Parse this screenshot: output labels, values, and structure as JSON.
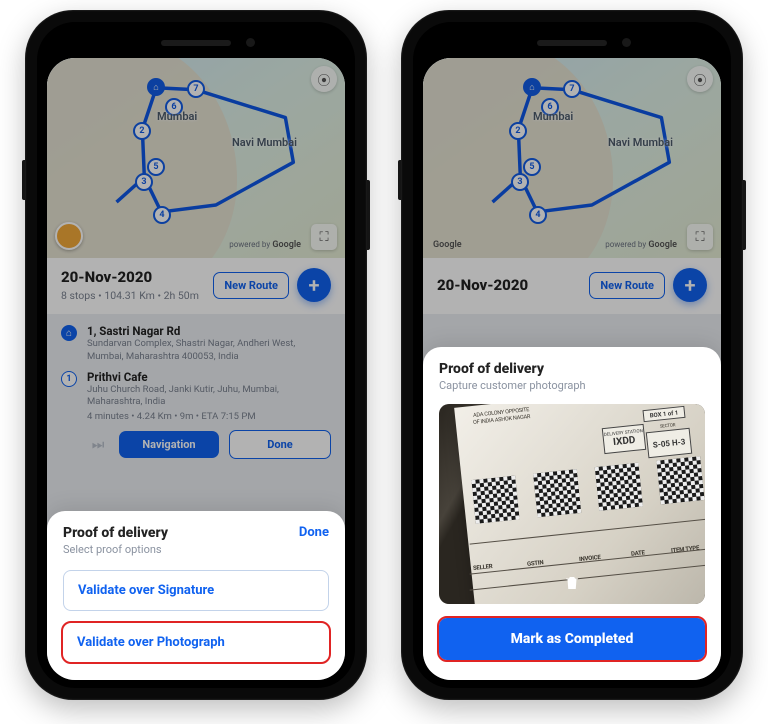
{
  "map": {
    "city1": "Mumbai",
    "city2": "Navi Mumbai",
    "attribution_prefix": "powered by",
    "attribution_brand": "Google",
    "attribution_brand_only": "Google",
    "markers": [
      "2",
      "3",
      "4",
      "5",
      "6",
      "7"
    ]
  },
  "header": {
    "date": "20-Nov-2020",
    "summary": "8 stops • 104.31 Km • 2h 50m",
    "new_route": "New Route"
  },
  "stops": {
    "home": {
      "title": "1, Sastri Nagar Rd",
      "line": "Sundarvan Complex, Shastri Nagar, Andheri West, Mumbai, Maharashtra 400053, India"
    },
    "s1": {
      "index": "1",
      "title": "Prithvi Cafe",
      "line": "Juhu Church Road, Janki Kutir, Juhu, Mumbai, Maharashtra, India",
      "meta": "4 minutes • 4.24 Km • 9m • ETA 7:15 PM"
    },
    "nav": "Navigation",
    "done": "Done"
  },
  "sheet_left": {
    "title": "Proof of delivery",
    "sub": "Select proof options",
    "done": "Done",
    "opt1": "Validate over Signature",
    "opt2": "Validate over Photograph"
  },
  "sheet_right": {
    "title": "Proof of delivery",
    "sub": "Capture customer photograph",
    "receipt": {
      "top1": "ADA COLONY OPPOSITE",
      "top2": "OF INDIA ASHOK NAGAR",
      "box1": "BOX 1 of 1",
      "station_lbl": "DELIVERY STATION",
      "station": "IXDD",
      "sector_lbl": "SECTOR",
      "sector": "S-05",
      "sector2": "H-3",
      "seller": "SELLER",
      "gstin": "GSTIN",
      "invoice": "INVOICE",
      "date": "DATE",
      "itemtype": "ITEM TYPE"
    },
    "button": "Mark as Completed"
  }
}
